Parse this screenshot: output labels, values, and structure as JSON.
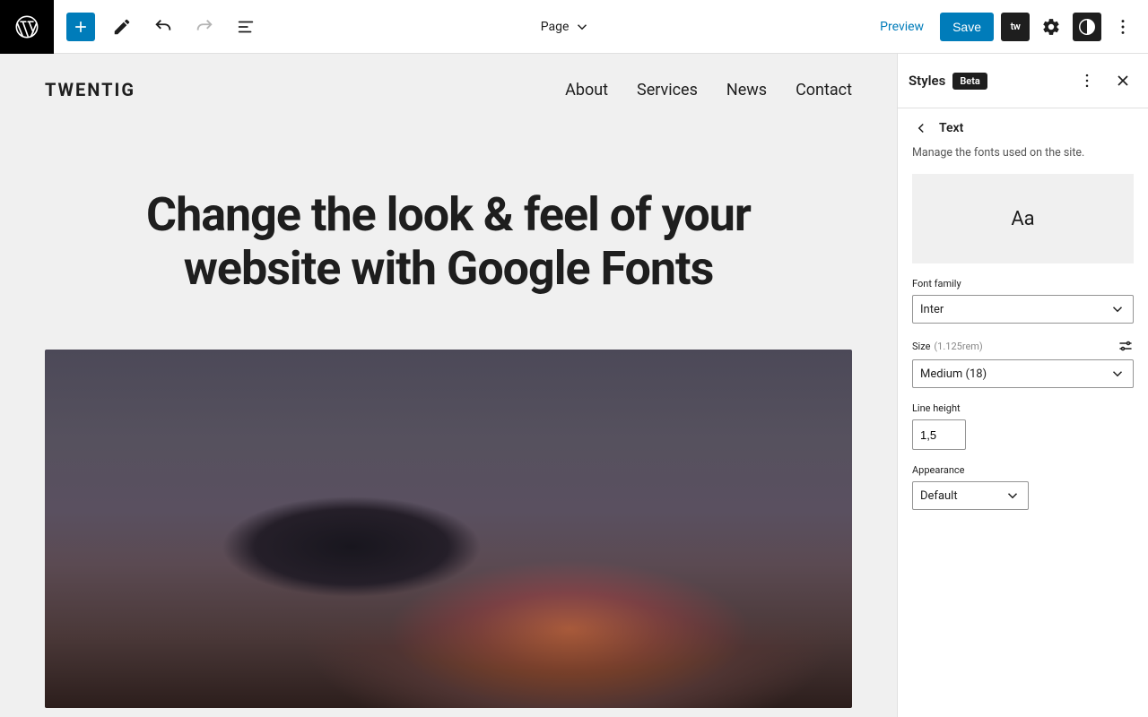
{
  "toolbar": {
    "doc_type": "Page",
    "preview": "Preview",
    "save": "Save",
    "tw_badge": "tw"
  },
  "page": {
    "site_title": "TWENTIG",
    "nav": [
      "About",
      "Services",
      "News",
      "Contact"
    ],
    "hero_title": "Change the look & feel of your website with Google Fonts"
  },
  "sidebar": {
    "title": "Styles",
    "badge": "Beta",
    "sub_title": "Text",
    "description": "Manage the fonts used on the site.",
    "preview_glyph": "Aa",
    "font_family": {
      "label": "Font family",
      "value": "Inter"
    },
    "size": {
      "label": "Size",
      "hint": "(1.125rem)",
      "value": "Medium (18)"
    },
    "line_height": {
      "label": "Line height",
      "value": "1,5"
    },
    "appearance": {
      "label": "Appearance",
      "value": "Default"
    }
  }
}
